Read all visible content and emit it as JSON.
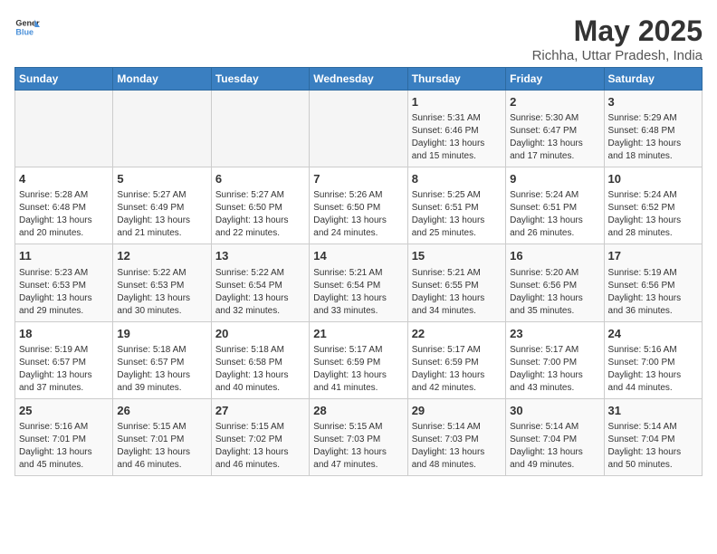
{
  "header": {
    "logo_general": "General",
    "logo_blue": "Blue",
    "title": "May 2025",
    "subtitle": "Richha, Uttar Pradesh, India"
  },
  "weekdays": [
    "Sunday",
    "Monday",
    "Tuesday",
    "Wednesday",
    "Thursday",
    "Friday",
    "Saturday"
  ],
  "weeks": [
    [
      {
        "day": "",
        "info": ""
      },
      {
        "day": "",
        "info": ""
      },
      {
        "day": "",
        "info": ""
      },
      {
        "day": "",
        "info": ""
      },
      {
        "day": "1",
        "info": "Sunrise: 5:31 AM\nSunset: 6:46 PM\nDaylight: 13 hours and 15 minutes."
      },
      {
        "day": "2",
        "info": "Sunrise: 5:30 AM\nSunset: 6:47 PM\nDaylight: 13 hours and 17 minutes."
      },
      {
        "day": "3",
        "info": "Sunrise: 5:29 AM\nSunset: 6:48 PM\nDaylight: 13 hours and 18 minutes."
      }
    ],
    [
      {
        "day": "4",
        "info": "Sunrise: 5:28 AM\nSunset: 6:48 PM\nDaylight: 13 hours and 20 minutes."
      },
      {
        "day": "5",
        "info": "Sunrise: 5:27 AM\nSunset: 6:49 PM\nDaylight: 13 hours and 21 minutes."
      },
      {
        "day": "6",
        "info": "Sunrise: 5:27 AM\nSunset: 6:50 PM\nDaylight: 13 hours and 22 minutes."
      },
      {
        "day": "7",
        "info": "Sunrise: 5:26 AM\nSunset: 6:50 PM\nDaylight: 13 hours and 24 minutes."
      },
      {
        "day": "8",
        "info": "Sunrise: 5:25 AM\nSunset: 6:51 PM\nDaylight: 13 hours and 25 minutes."
      },
      {
        "day": "9",
        "info": "Sunrise: 5:24 AM\nSunset: 6:51 PM\nDaylight: 13 hours and 26 minutes."
      },
      {
        "day": "10",
        "info": "Sunrise: 5:24 AM\nSunset: 6:52 PM\nDaylight: 13 hours and 28 minutes."
      }
    ],
    [
      {
        "day": "11",
        "info": "Sunrise: 5:23 AM\nSunset: 6:53 PM\nDaylight: 13 hours and 29 minutes."
      },
      {
        "day": "12",
        "info": "Sunrise: 5:22 AM\nSunset: 6:53 PM\nDaylight: 13 hours and 30 minutes."
      },
      {
        "day": "13",
        "info": "Sunrise: 5:22 AM\nSunset: 6:54 PM\nDaylight: 13 hours and 32 minutes."
      },
      {
        "day": "14",
        "info": "Sunrise: 5:21 AM\nSunset: 6:54 PM\nDaylight: 13 hours and 33 minutes."
      },
      {
        "day": "15",
        "info": "Sunrise: 5:21 AM\nSunset: 6:55 PM\nDaylight: 13 hours and 34 minutes."
      },
      {
        "day": "16",
        "info": "Sunrise: 5:20 AM\nSunset: 6:56 PM\nDaylight: 13 hours and 35 minutes."
      },
      {
        "day": "17",
        "info": "Sunrise: 5:19 AM\nSunset: 6:56 PM\nDaylight: 13 hours and 36 minutes."
      }
    ],
    [
      {
        "day": "18",
        "info": "Sunrise: 5:19 AM\nSunset: 6:57 PM\nDaylight: 13 hours and 37 minutes."
      },
      {
        "day": "19",
        "info": "Sunrise: 5:18 AM\nSunset: 6:57 PM\nDaylight: 13 hours and 39 minutes."
      },
      {
        "day": "20",
        "info": "Sunrise: 5:18 AM\nSunset: 6:58 PM\nDaylight: 13 hours and 40 minutes."
      },
      {
        "day": "21",
        "info": "Sunrise: 5:17 AM\nSunset: 6:59 PM\nDaylight: 13 hours and 41 minutes."
      },
      {
        "day": "22",
        "info": "Sunrise: 5:17 AM\nSunset: 6:59 PM\nDaylight: 13 hours and 42 minutes."
      },
      {
        "day": "23",
        "info": "Sunrise: 5:17 AM\nSunset: 7:00 PM\nDaylight: 13 hours and 43 minutes."
      },
      {
        "day": "24",
        "info": "Sunrise: 5:16 AM\nSunset: 7:00 PM\nDaylight: 13 hours and 44 minutes."
      }
    ],
    [
      {
        "day": "25",
        "info": "Sunrise: 5:16 AM\nSunset: 7:01 PM\nDaylight: 13 hours and 45 minutes."
      },
      {
        "day": "26",
        "info": "Sunrise: 5:15 AM\nSunset: 7:01 PM\nDaylight: 13 hours and 46 minutes."
      },
      {
        "day": "27",
        "info": "Sunrise: 5:15 AM\nSunset: 7:02 PM\nDaylight: 13 hours and 46 minutes."
      },
      {
        "day": "28",
        "info": "Sunrise: 5:15 AM\nSunset: 7:03 PM\nDaylight: 13 hours and 47 minutes."
      },
      {
        "day": "29",
        "info": "Sunrise: 5:14 AM\nSunset: 7:03 PM\nDaylight: 13 hours and 48 minutes."
      },
      {
        "day": "30",
        "info": "Sunrise: 5:14 AM\nSunset: 7:04 PM\nDaylight: 13 hours and 49 minutes."
      },
      {
        "day": "31",
        "info": "Sunrise: 5:14 AM\nSunset: 7:04 PM\nDaylight: 13 hours and 50 minutes."
      }
    ]
  ]
}
